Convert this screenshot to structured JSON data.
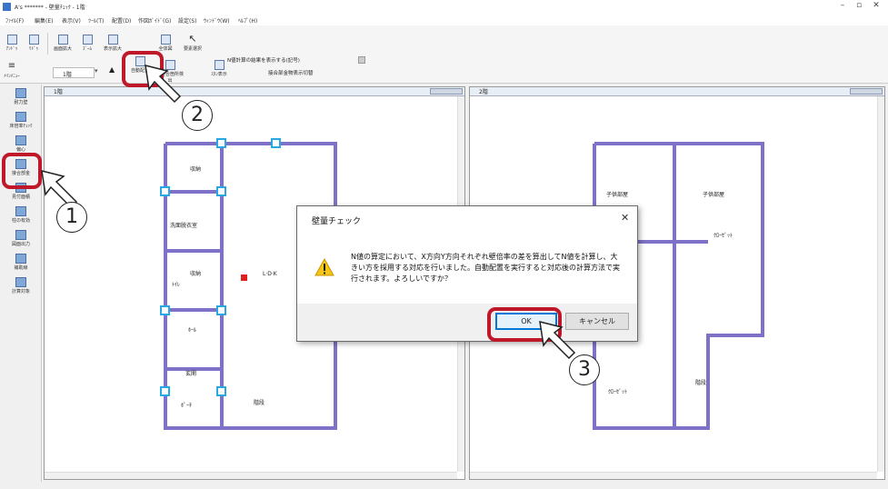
{
  "window": {
    "title": "A's ******* - 壁量ﾁｪｯｸ - 1階"
  },
  "menu": [
    "ﾌｧｲﾙ(F)",
    "編集(E)",
    "表示(V)",
    "ﾂｰﾙ(T)",
    "配置(D)",
    "作図ｶﾞｲﾄﾞ(G)",
    "設定(S)",
    "ｳｨﾝﾄﾞｳ(W)",
    "ﾍﾙﾌﾟ(H)"
  ],
  "toolbar": {
    "items": [
      "ｱﾝﾄﾞｩ",
      "ﾘﾄﾞｩ",
      "画面拡大",
      "ｽﾞｰﾑ",
      "表示拡大",
      "全体図",
      "要素選択"
    ],
    "menu_label": "ﾒｲﾝﾒﾆｭｰ",
    "floor": "1階",
    "auto_place": "自動配置",
    "metal_check": "不整合箇所検出",
    "stud": "ｽﾀﾝ表示",
    "ncalc_label": "N値計算の結果を表示する(記号)",
    "kanagu_label": "接合部金物表示切替"
  },
  "sidebar": [
    "耐力壁",
    "床倍率ﾁｪｯｸ",
    "偏心",
    "接合部金",
    "見付面積",
    "柱の有効",
    "図面出力",
    "補助線",
    "計算対象"
  ],
  "pane_left": {
    "title": "1階"
  },
  "pane_right": {
    "title": "2階"
  },
  "plan_labels_left": [
    "収納",
    "洗面脱衣室",
    "ﾄｲﾚ",
    "ﾎｰﾙ",
    "玄関",
    "ﾎﾟｰﾁ",
    "階段",
    "L·D·K",
    "収納"
  ],
  "plan_labels_right": [
    "子供部屋",
    "子供部屋",
    "ｸﾛｰｾﾞｯﾄ",
    "ｸﾛｰｾﾞｯﾄ",
    "階段"
  ],
  "dialog": {
    "title": "壁量チェック",
    "message": "N値の算定において、X方向Y方向それぞれ壁倍率の差を算出してN値を計算し、大きい方を採用する対応を行いました。自動配置を実行すると対応後の計算方法で実行されます。よろしいですか？",
    "ok": "OK",
    "cancel": "キャンセル"
  },
  "callouts": [
    "1",
    "2",
    "3"
  ],
  "colors": {
    "highlight": "#c0182b",
    "wall": "#7e72c8",
    "node": "#28a8e0",
    "accent": "#0078d7"
  }
}
